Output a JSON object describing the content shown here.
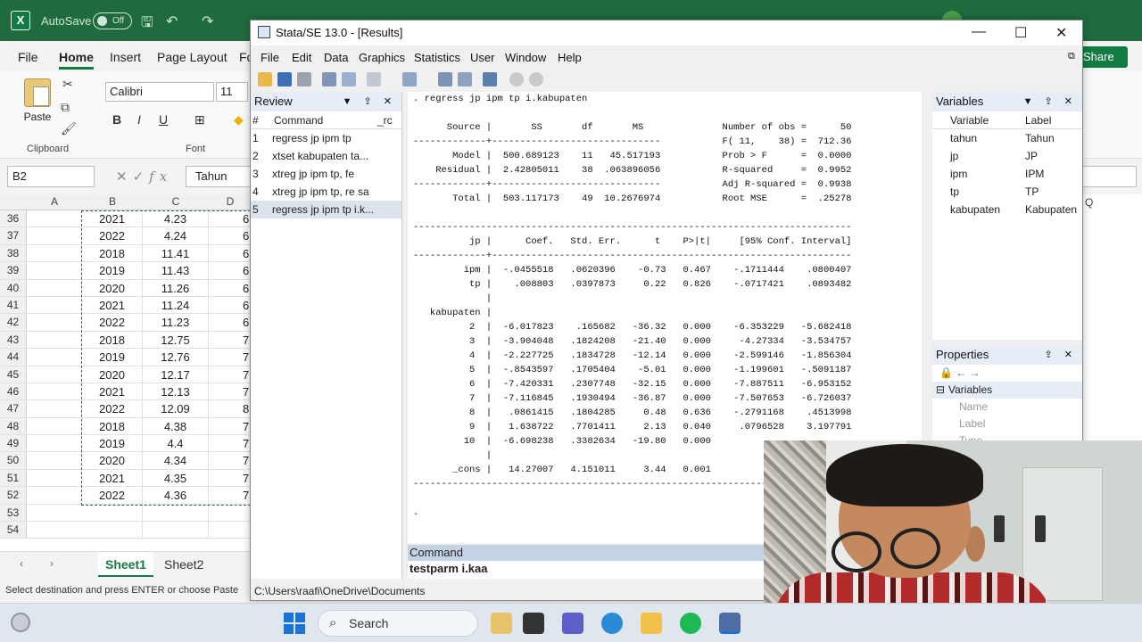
{
  "excel": {
    "autosave_label": "AutoSave",
    "autosave_state": "Off",
    "menu_tabs": [
      "File",
      "Home",
      "Insert",
      "Page Layout",
      "Fo"
    ],
    "share_label": "Share",
    "paste_label": "Paste",
    "clipboard_label": "Clipboard",
    "font_label": "Font",
    "font_name": "Calibri",
    "font_size": "11",
    "format_buttons": [
      "B",
      "I",
      "U"
    ],
    "name_box": "B2",
    "formula_value": "Tahun",
    "columns": [
      "A",
      "B",
      "C",
      "D",
      "Q"
    ],
    "rows": [
      {
        "n": "36",
        "b": "2021",
        "c": "4.23",
        "d": "6"
      },
      {
        "n": "37",
        "b": "2022",
        "c": "4.24",
        "d": "6"
      },
      {
        "n": "38",
        "b": "2018",
        "c": "11.41",
        "d": "6"
      },
      {
        "n": "39",
        "b": "2019",
        "c": "11.43",
        "d": "6"
      },
      {
        "n": "40",
        "b": "2020",
        "c": "11.26",
        "d": "6"
      },
      {
        "n": "41",
        "b": "2021",
        "c": "11.24",
        "d": "6"
      },
      {
        "n": "42",
        "b": "2022",
        "c": "11.23",
        "d": "6"
      },
      {
        "n": "43",
        "b": "2018",
        "c": "12.75",
        "d": "7"
      },
      {
        "n": "44",
        "b": "2019",
        "c": "12.76",
        "d": "7"
      },
      {
        "n": "45",
        "b": "2020",
        "c": "12.17",
        "d": "7"
      },
      {
        "n": "46",
        "b": "2021",
        "c": "12.13",
        "d": "7"
      },
      {
        "n": "47",
        "b": "2022",
        "c": "12.09",
        "d": "8"
      },
      {
        "n": "48",
        "b": "2018",
        "c": "4.38",
        "d": "7"
      },
      {
        "n": "49",
        "b": "2019",
        "c": "4.4",
        "d": "7"
      },
      {
        "n": "50",
        "b": "2020",
        "c": "4.34",
        "d": "7"
      },
      {
        "n": "51",
        "b": "2021",
        "c": "4.35",
        "d": "7"
      },
      {
        "n": "52",
        "b": "2022",
        "c": "4.36",
        "d": "7"
      },
      {
        "n": "53",
        "b": "",
        "c": "",
        "d": ""
      },
      {
        "n": "54",
        "b": "",
        "c": "",
        "d": ""
      }
    ],
    "sheets": [
      "Sheet1",
      "Sheet2"
    ],
    "status": "Select destination and press ENTER or choose Paste",
    "accent_color": "#107c41"
  },
  "stata": {
    "title": "Stata/SE 13.0 - [Results]",
    "menu": [
      "File",
      "Edit",
      "Data",
      "Graphics",
      "Statistics",
      "User",
      "Window",
      "Help"
    ],
    "review": {
      "title": "Review",
      "col_num": "#",
      "col_cmd": "Command",
      "col_rc": "_rc",
      "items": [
        {
          "n": "1",
          "cmd": "regress jp ipm tp"
        },
        {
          "n": "2",
          "cmd": "xtset kabupaten ta..."
        },
        {
          "n": "3",
          "cmd": "xtreg jp ipm tp, fe"
        },
        {
          "n": "4",
          "cmd": "xtreg jp ipm tp, re sa"
        },
        {
          "n": "5",
          "cmd": "regress jp ipm tp i.k..."
        }
      ]
    },
    "results_text": ". regress jp ipm tp i.kabupaten\n\n      Source |       SS       df       MS              Number of obs =      50\n-------------+------------------------------           F( 11,    38) =  712.36\n       Model |  500.689123    11   45.517193           Prob > F      =  0.0000\n    Residual |  2.42805011    38  .063896056           R-squared     =  0.9952\n-------------+------------------------------           Adj R-squared =  0.9938\n       Total |  503.117173    49  10.2676974           Root MSE      =  .25278\n\n------------------------------------------------------------------------------\n          jp |      Coef.   Std. Err.      t    P>|t|     [95% Conf. Interval]\n-------------+----------------------------------------------------------------\n         ipm |  -.0455518   .0620396    -0.73   0.467    -.1711444    .0800407\n          tp |    .008803   .0397873     0.22   0.826    -.0717421    .0893482\n             |\n   kabupaten |\n          2  |  -6.017823    .165682   -36.32   0.000    -6.353229   -5.682418\n          3  |  -3.904048   .1824208   -21.40   0.000     -4.27334   -3.534757\n          4  |  -2.227725   .1834728   -12.14   0.000    -2.599146   -1.856304\n          5  |  -.8543597   .1705404    -5.01   0.000    -1.199601   -.5091187\n          6  |  -7.420331   .2307748   -32.15   0.000    -7.887511   -6.953152\n          7  |  -7.116845   .1930494   -36.87   0.000    -7.507653   -6.726037\n          8  |   .0861415   .1804285     0.48   0.636    -.2791168    .4513998\n          9  |   1.638722   .7701411     2.13   0.040     .0796528    3.197791\n         10  |  -6.698238   .3382634   -19.80   0.000\n             |\n       _cons |   14.27007   4.151011     3.44   0.001\n------------------------------------------------------------------------------\n\n.",
    "command_label": "Command",
    "command_value": "testparm i.kaa",
    "path": "C:\\Users\\raafi\\OneDrive\\Documents",
    "variables": {
      "title": "Variables",
      "col_var": "Variable",
      "col_label": "Label",
      "items": [
        {
          "name": "tahun",
          "label": "Tahun"
        },
        {
          "name": "jp",
          "label": "JP"
        },
        {
          "name": "ipm",
          "label": "IPM"
        },
        {
          "name": "tp",
          "label": "TP"
        },
        {
          "name": "kabupaten",
          "label": "Kabupaten"
        }
      ]
    },
    "properties": {
      "title": "Properties",
      "section": "Variables",
      "fields": [
        "Name",
        "Label",
        "Type"
      ]
    }
  },
  "taskbar": {
    "search_placeholder": "Search",
    "apps": [
      "file-explorer-icon",
      "chat-icon",
      "edge-icon",
      "folder-icon",
      "spotify-icon",
      "stata-icon"
    ]
  }
}
